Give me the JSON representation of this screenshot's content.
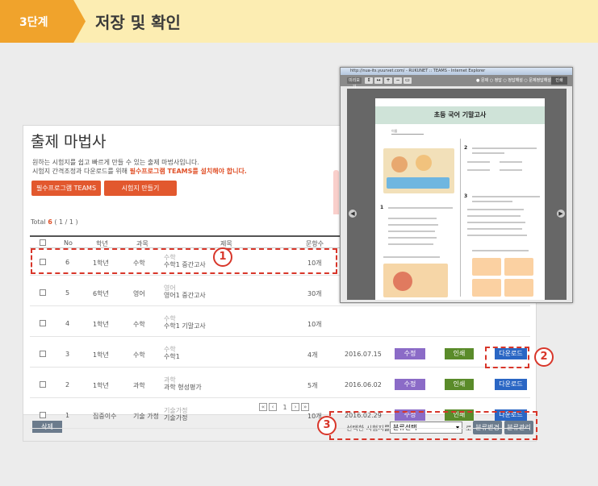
{
  "header": {
    "step": "3단계",
    "title": "저장 및 확인"
  },
  "panel": {
    "title": "출제 마법사",
    "desc_line1": "원하는 시험지를 쉽고 빠르게 만들 수 있는 출제 마법사입니다.",
    "desc_line2_prefix": "시험지 간격조정과 다운로드를 위해 ",
    "desc_line2_highlight": "필수프로그램 TEAMS를 설치해야 합니다.",
    "btn_teams": "필수프로그램 TEAMS",
    "btn_make": "시험지 만들기",
    "total_label": "Total",
    "total_count": "6",
    "total_pages": "( 1 / 1 )"
  },
  "table": {
    "headers": {
      "no": "No",
      "grade": "학년",
      "subject": "과목",
      "title": "제목",
      "count": "문항수"
    },
    "rows": [
      {
        "no": "6",
        "grade": "1학년",
        "subject": "수학",
        "title_sub": "수학",
        "title": "수학1 중간고사",
        "count": "10개",
        "date": "",
        "actions": false
      },
      {
        "no": "5",
        "grade": "6학년",
        "subject": "영어",
        "title_sub": "영어",
        "title": "영어1 중간고사",
        "count": "30개",
        "date": "",
        "actions": false
      },
      {
        "no": "4",
        "grade": "1학년",
        "subject": "수학",
        "title_sub": "수학",
        "title": "수학1 기말고사",
        "count": "10개",
        "date": "",
        "actions": false
      },
      {
        "no": "3",
        "grade": "1학년",
        "subject": "수학",
        "title_sub": "수학",
        "title": "수학1",
        "count": "4개",
        "date": "2016.07.15",
        "actions": true
      },
      {
        "no": "2",
        "grade": "1학년",
        "subject": "과학",
        "title_sub": "과학",
        "title": "과학 형성평가",
        "count": "5개",
        "date": "2016.06.02",
        "actions": true
      },
      {
        "no": "1",
        "grade": "집중이수",
        "subject": "기술 가정",
        "title_sub": "기술가정",
        "title": "기술가정",
        "count": "10개",
        "date": "2016.02.29",
        "actions": true
      }
    ],
    "action_labels": {
      "edit": "수정",
      "print": "인쇄",
      "download": "다운로드"
    }
  },
  "pager": {
    "first": "«",
    "prev": "‹",
    "current": "1",
    "next": "›",
    "last": "»"
  },
  "bottom": {
    "delete": "삭제",
    "selected_label": "선택한 시험지를",
    "select_value": "분류선택",
    "to_label": "로",
    "btn_change": "분류변경",
    "btn_manage": "분류관리"
  },
  "callouts": {
    "one": "1",
    "two": "2",
    "three": "3"
  },
  "popup": {
    "window_title": "http://nua-its.yuurvet.com/ - RUKUNET :: TEAMS - Internet Explorer",
    "preview": "미리보기",
    "options": "● 문제 ○ 정답 ○ 정답해설 ○ 문제정답해설",
    "print": "인쇄",
    "doc_title": "초등 국어 기말고사",
    "name_label": "이름"
  },
  "colors": {
    "accent_orange": "#f0a32c",
    "red": "#e2582e",
    "callout": "#d8362a"
  }
}
